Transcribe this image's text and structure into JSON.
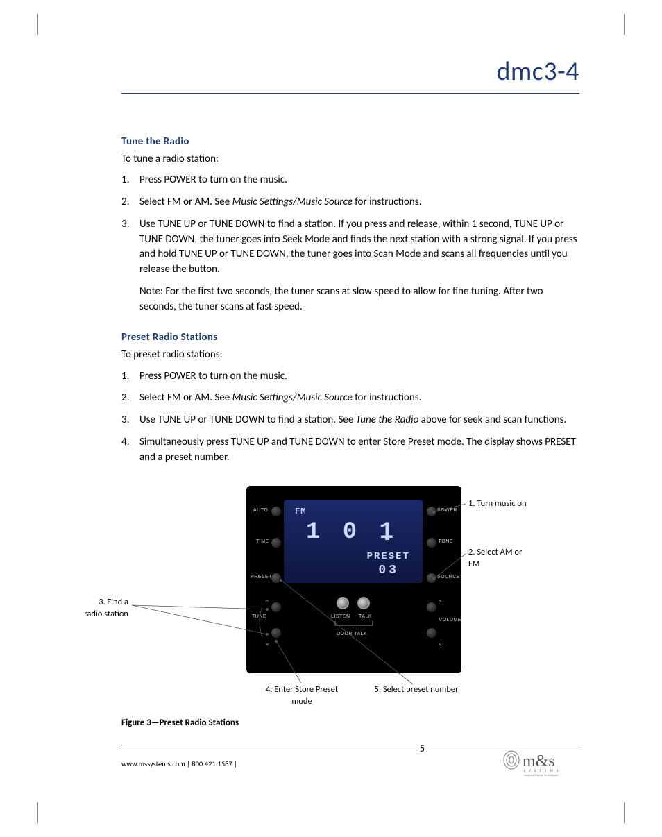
{
  "header": {
    "product_title": "dmc3-4"
  },
  "section1": {
    "heading": "Tune the Radio",
    "intro": "To tune a radio station:",
    "items": [
      {
        "text": "Press POWER to turn on the music."
      },
      {
        "pre": "Select FM or AM. See ",
        "ital": "Music Settings/Music Source",
        "post": " for instructions."
      },
      {
        "text": "Use TUNE UP or TUNE DOWN to find a station. If you press and release, within 1 second, TUNE UP or TUNE DOWN, the tuner goes into Seek Mode and finds the next station with a strong signal. If you press and hold TUNE UP or TUNE DOWN, the tuner goes into Scan Mode and scans all frequencies until you release the button.",
        "sub": "Note: For the first two seconds, the tuner scans at slow speed to allow for fine tuning. After two seconds, the tuner scans at fast speed."
      }
    ]
  },
  "section2": {
    "heading": "Preset Radio Stations",
    "intro": "To preset radio stations:",
    "items": [
      {
        "text": "Press POWER to turn on the music."
      },
      {
        "pre": "Select FM or AM. See ",
        "ital": "Music Settings/Music Source",
        "post": " for instructions."
      },
      {
        "pre": "Use TUNE UP or TUNE DOWN to find a station. See ",
        "ital": "Tune the Radio",
        "post": " above for seek and scan functions."
      },
      {
        "text": "Simultaneously press TUNE UP and TUNE DOWN to enter Store Preset mode. The display shows PRESET and a preset number."
      }
    ]
  },
  "panel": {
    "lcd": {
      "band": "FM",
      "freq": "1 0 1",
      "preset_label": "PRESET",
      "preset_num": "03"
    },
    "labels": {
      "auto": "AUTO",
      "time": "TIME",
      "preset": "PRESET",
      "power": "POWER",
      "tone": "TONE",
      "source": "SOURCE",
      "tune": "TUNE",
      "listen": "LISTEN",
      "talk": "TALK",
      "doortalk": "DOOR TALK",
      "volume": "VOLUME"
    }
  },
  "callouts": {
    "c1": "1. Turn music on",
    "c2a": "2. Select AM or",
    "c2b": "FM",
    "c3a": "3. Find a",
    "c3b": "radio station",
    "c4a": "4. Enter Store Preset",
    "c4b": "mode",
    "c5": "5. Select preset number"
  },
  "figure_caption": "Figure 3—Preset Radio Stations",
  "footer": {
    "info": "www.mssystems.com | 800.421.1587 |",
    "page": "5",
    "brand_main": "m&s",
    "brand_sub": "S Y S T E M S",
    "brand_tag": "Integrated Home Technologies"
  }
}
